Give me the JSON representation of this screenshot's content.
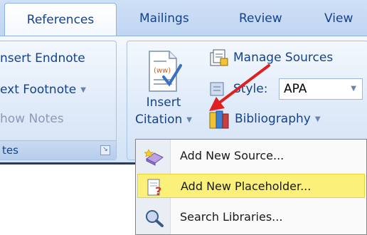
{
  "tabs": [
    "References",
    "Mailings",
    "Review",
    "View"
  ],
  "footnotes_group": {
    "items": [
      "nsert Endnote",
      "ext Footnote",
      "how Notes"
    ],
    "title": "tes"
  },
  "citations_group": {
    "insert_citation": [
      "Insert",
      "Citation"
    ],
    "manage_sources": "Manage Sources",
    "style_label": "Style:",
    "style_value": "APA",
    "bibliography": "Bibliography"
  },
  "menu": {
    "items": [
      {
        "label": "Add New Source...",
        "icon": "book-add-icon",
        "highlighted": false
      },
      {
        "label": "Add New Placeholder...",
        "icon": "placeholder-icon",
        "highlighted": true
      },
      {
        "label": "Search Libraries...",
        "icon": "magnifier-icon",
        "highlighted": false
      }
    ]
  },
  "colors": {
    "ribbon_text": "#15428b",
    "highlight": "#fbf17a",
    "arrow": "#e02020"
  }
}
